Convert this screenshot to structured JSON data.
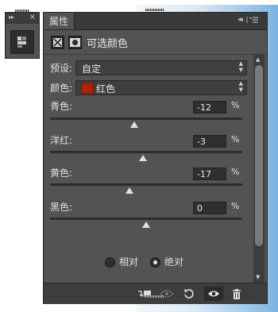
{
  "panel": {
    "tab_label": "属性",
    "title": "可选颜色"
  },
  "preset": {
    "label": "预设:",
    "value": "自定"
  },
  "colors": {
    "label": "颜色:",
    "value": "红色",
    "swatch_color": "#b32004"
  },
  "sliders": [
    {
      "label": "青色:",
      "value": "-12",
      "unit": "%",
      "level": -12
    },
    {
      "label": "洋红:",
      "value": "-3",
      "unit": "%",
      "level": -3
    },
    {
      "label": "黄色:",
      "value": "-17",
      "unit": "%",
      "level": -17
    },
    {
      "label": "黑色:",
      "value": "0",
      "unit": "%",
      "level": 0
    }
  ],
  "method": {
    "options": [
      "相对",
      "绝对"
    ],
    "selected": "绝对"
  },
  "footer_icons": [
    "clip-to-layer-icon",
    "view-previous-icon",
    "reset-icon",
    "visibility-eye-icon",
    "trash-icon"
  ]
}
